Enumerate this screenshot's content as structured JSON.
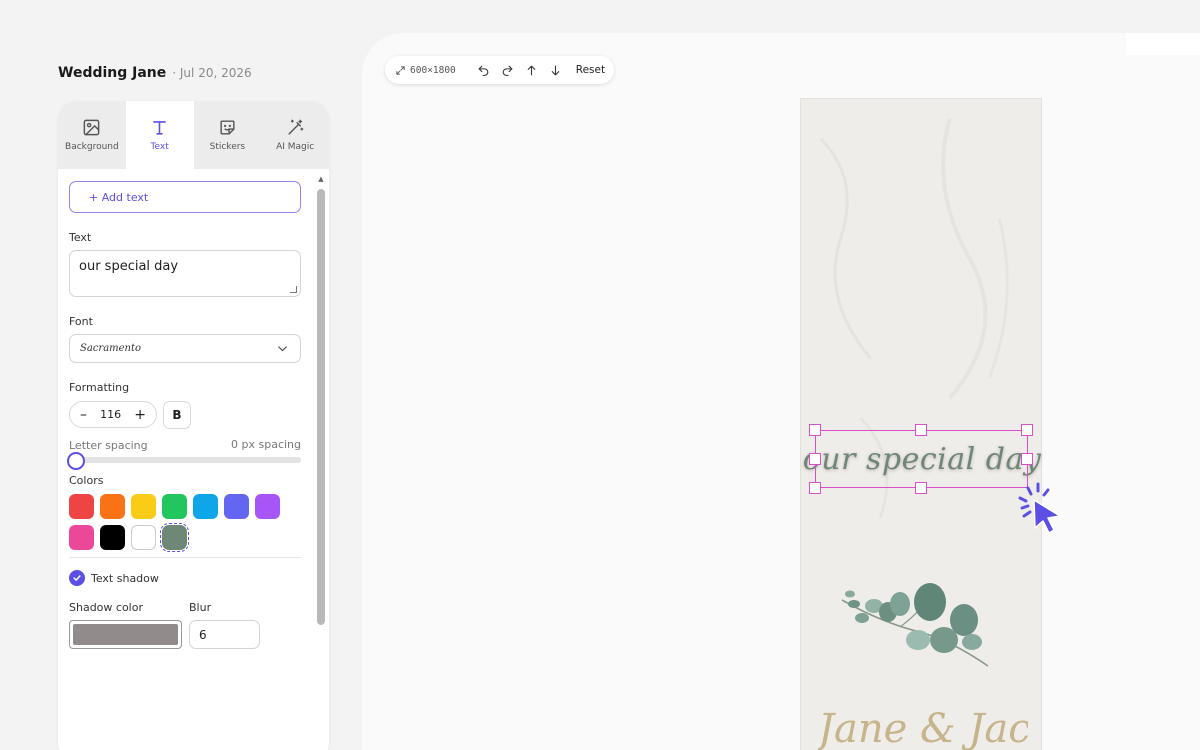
{
  "project": {
    "name": "Wedding Jane",
    "date": "· Jul 20, 2026"
  },
  "tabs": [
    {
      "label": "Background",
      "icon": "image-icon"
    },
    {
      "label": "Text",
      "icon": "text-icon"
    },
    {
      "label": "Stickers",
      "icon": "sticker-icon"
    },
    {
      "label": "AI Magic",
      "icon": "magic-wand-icon"
    }
  ],
  "active_tab": "Text",
  "text_panel": {
    "add_text_label": "+ Add text",
    "text_label": "Text",
    "text_value": "our special day",
    "font_label": "Font",
    "font_value": "Sacramento",
    "formatting_label": "Formatting",
    "font_size": "116",
    "minus": "–",
    "plus": "+",
    "bold": "B",
    "letter_spacing_label": "Letter spacing",
    "letter_spacing_value": "0 px spacing",
    "letter_spacing_fraction": 0.0,
    "colors_label": "Colors",
    "colors": [
      "#ef4444",
      "#f97316",
      "#facc15",
      "#22c55e",
      "#0ea5e9",
      "#6366f1",
      "#a855f7",
      "#ec4899",
      "#000000",
      "#ffffff",
      "#6f8777"
    ],
    "selected_color": "#6f8777",
    "text_shadow_label": "Text shadow",
    "text_shadow_checked": true,
    "shadow_color_label": "Shadow color",
    "shadow_color": "#928b8b",
    "blur_label": "Blur",
    "blur_value": "6"
  },
  "toolbar": {
    "dimensions": "600×1800",
    "reset_label": "Reset"
  },
  "canvas": {
    "selected_text": "our special day",
    "names_text": "Jane & Jack",
    "accent": "#5b4fe6",
    "selection_color": "#d84fc8"
  }
}
